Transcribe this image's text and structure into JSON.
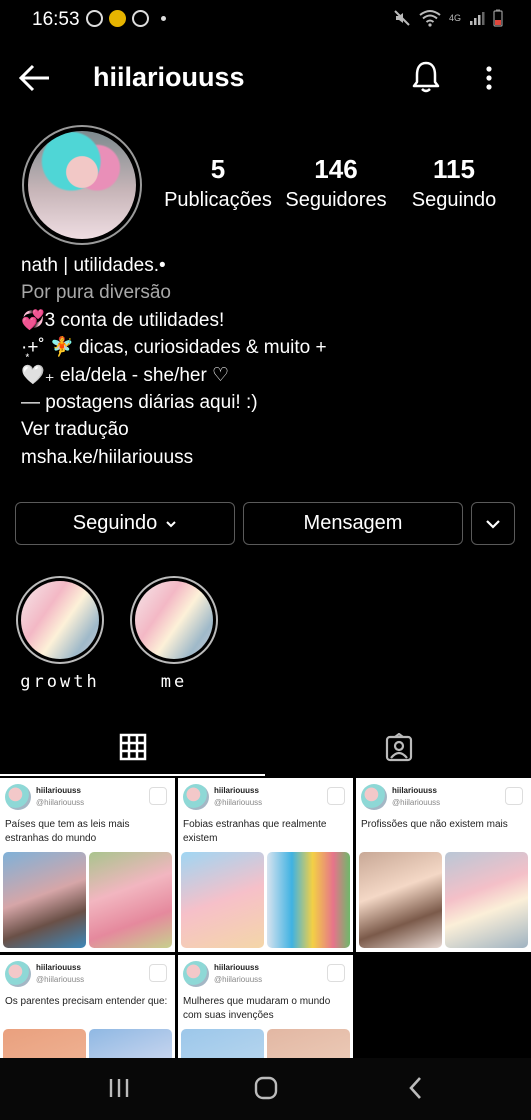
{
  "status_bar": {
    "time": "16:53",
    "network": "4G",
    "icons_left": [
      "sync-icon",
      "youtube-icon",
      "pinterest-icon"
    ],
    "icons_right": [
      "mute-icon",
      "wifi-icon",
      "signal-icon",
      "battery-icon"
    ]
  },
  "header": {
    "username": "hiilariouuss"
  },
  "profile": {
    "stats": [
      {
        "value": "5",
        "label": "Publicações"
      },
      {
        "value": "146",
        "label": "Seguidores"
      },
      {
        "value": "115",
        "label": "Seguindo"
      }
    ],
    "bio": {
      "name": "nath | utilidades.•",
      "category": "Por pura diversão",
      "lines": [
        "💞3 conta de utilidades!",
        "·͙+˚ 🧚 dicas, curiosidades & muito +",
        "🤍₊ ela/dela - she/her ♡",
        "—  postagens diárias aqui! :)"
      ],
      "translate": "Ver tradução",
      "link": "msha.ke/hiilariouuss"
    }
  },
  "actions": {
    "following_label": "Seguindo",
    "message_label": "Mensagem"
  },
  "highlights": [
    {
      "label": "growth"
    },
    {
      "label": "me"
    }
  ],
  "tabs": [
    "grid-icon",
    "tagged-icon"
  ],
  "posts": [
    {
      "name": "hiilariouuss",
      "handle": "@hiilariouuss",
      "text": "Países que tem as leis mais estranhas do mundo"
    },
    {
      "name": "hiilariouuss",
      "handle": "@hiilariouuss",
      "text": "Fobias estranhas que realmente existem"
    },
    {
      "name": "hiilariouuss",
      "handle": "@hiilariouuss",
      "text": "Profissões que não existem mais"
    },
    {
      "name": "hiilariouuss",
      "handle": "@hiilariouuss",
      "text": "Os parentes precisam entender que:"
    },
    {
      "name": "hiilariouuss",
      "handle": "@hiilariouuss",
      "text": "Mulheres que mudaram o mundo com suas invenções"
    }
  ],
  "nav_bar": [
    "recent-apps-icon",
    "home-icon",
    "back-nav-icon"
  ]
}
